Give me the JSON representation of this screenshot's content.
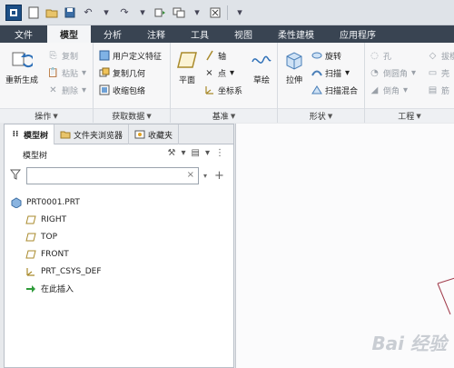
{
  "qat": {
    "icons": [
      "app-icon",
      "new-file-icon",
      "open-folder-icon",
      "save-icon",
      "undo-icon",
      "redo-icon",
      "regenerate-icon",
      "windows-icon",
      "close-window-icon",
      "customize-icon"
    ]
  },
  "tabs": [
    "文件",
    "模型",
    "分析",
    "注释",
    "工具",
    "视图",
    "柔性建模",
    "应用程序"
  ],
  "active_tab": "模型",
  "ribbon": {
    "operations": {
      "label": "操作",
      "regenerate": "重新生成",
      "copy": "复制",
      "paste": "粘贴",
      "delete": "删除"
    },
    "get_data": {
      "label": "获取数据",
      "udf": "用户定义特征",
      "copy_geom": "复制几何",
      "shrinkwrap": "收缩包络"
    },
    "datum": {
      "label": "基准",
      "plane": "平面",
      "axis": "轴",
      "point": "点",
      "csys": "坐标系",
      "sketch": "草绘"
    },
    "shapes": {
      "label": "形状",
      "extrude": "拉伸",
      "revolve": "旋转",
      "sweep": "扫描",
      "swept_blend": "扫描混合"
    },
    "engineering": {
      "label": "工程",
      "hole": "孔",
      "round": "倒圆角",
      "chamfer": "倒角",
      "draft": "拔模",
      "shell": "壳",
      "rib": "筋"
    }
  },
  "panel": {
    "tabs": [
      "模型树",
      "文件夹浏览器",
      "收藏夹"
    ],
    "header": "模型树",
    "filter_placeholder": "",
    "tree": [
      {
        "label": "PRT0001.PRT",
        "icon": "part-icon"
      },
      {
        "label": "RIGHT",
        "icon": "datum-plane-icon"
      },
      {
        "label": "TOP",
        "icon": "datum-plane-icon"
      },
      {
        "label": "FRONT",
        "icon": "datum-plane-icon"
      },
      {
        "label": "PRT_CSYS_DEF",
        "icon": "csys-icon"
      },
      {
        "label": "在此插入",
        "icon": "insert-arrow-icon"
      }
    ]
  },
  "watermark": "Bai 经验",
  "colors": {
    "tab_bar": "#394452",
    "active_tab_bg": "#f4f5f7",
    "panel_bg": "#ffffff"
  }
}
